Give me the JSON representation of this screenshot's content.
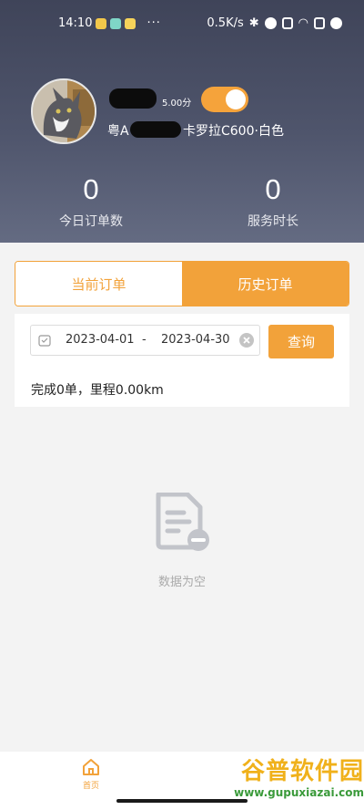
{
  "status_bar": {
    "time": "14:10",
    "dots": "···",
    "network_speed": "0.5K/s"
  },
  "profile": {
    "rating": "5.00分",
    "plate_prefix": "粤A",
    "car": "卡罗拉C600·白色",
    "online_toggle": true
  },
  "stats": {
    "orders_today": {
      "value": "0",
      "label": "今日订单数"
    },
    "service_time": {
      "value": "0",
      "label": "服务时长"
    }
  },
  "tabs": [
    {
      "label": "当前订单",
      "active": false
    },
    {
      "label": "历史订单",
      "active": true
    }
  ],
  "filter": {
    "start_date": "2023-04-01",
    "separator": "-",
    "end_date": "2023-04-30",
    "query_label": "查询"
  },
  "summary": "完成0单，里程0.00km",
  "empty": {
    "text": "数据为空"
  },
  "bottom_nav": {
    "home_label": "首页"
  },
  "watermark": {
    "title": "谷普软件园",
    "url": "www.gupuxiazai.com"
  },
  "colors": {
    "accent": "#f2a23a",
    "header_top": "#3f4459",
    "header_bottom": "#646b82"
  }
}
